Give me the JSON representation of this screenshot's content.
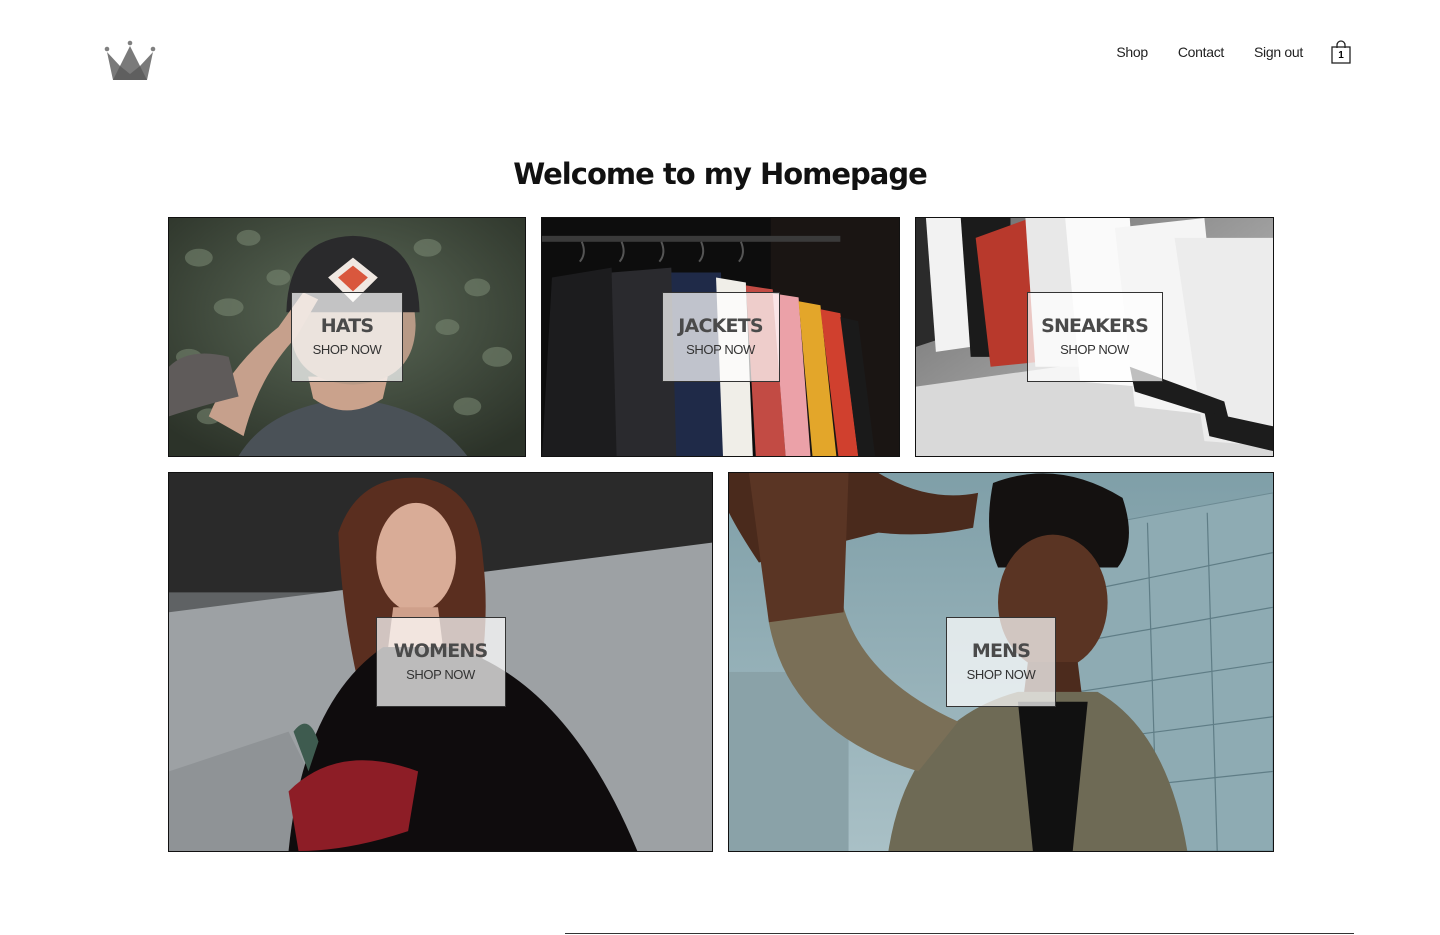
{
  "nav": {
    "shop": "Shop",
    "contact": "Contact",
    "sign_out": "Sign out",
    "cart_count": "1"
  },
  "page": {
    "title": "Welcome to my Homepage"
  },
  "categories": [
    {
      "title": "HATS",
      "subtitle": "SHOP NOW"
    },
    {
      "title": "JACKETS",
      "subtitle": "SHOP NOW"
    },
    {
      "title": "SNEAKERS",
      "subtitle": "SHOP NOW"
    },
    {
      "title": "WOMENS",
      "subtitle": "SHOP NOW"
    },
    {
      "title": "MENS",
      "subtitle": "SHOP NOW"
    }
  ],
  "icons": {
    "logo": "crown-logo-icon",
    "cart": "shopping-bag-icon"
  },
  "colors": {
    "logo": "#808080",
    "text": "#222222",
    "overlay_text": "#4a4a4a"
  }
}
